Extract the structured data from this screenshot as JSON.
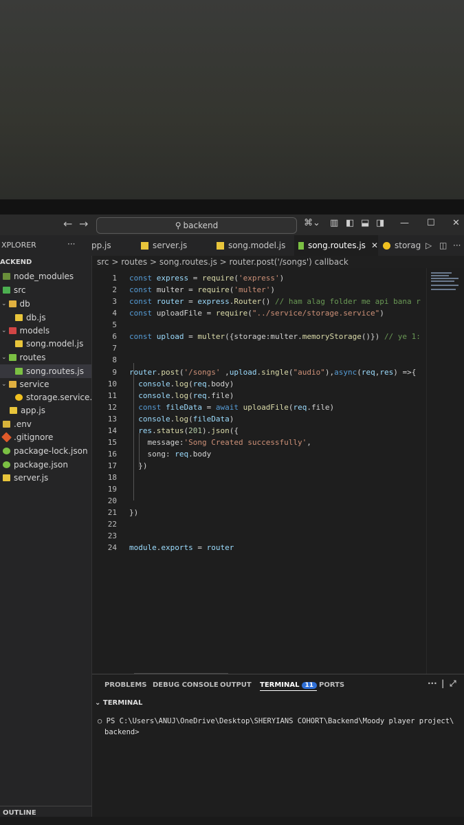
{
  "window": {
    "search": "backend"
  },
  "tabs": [
    {
      "label": "pp.js"
    },
    {
      "label": "server.js"
    },
    {
      "label": "song.model.js"
    },
    {
      "label": "song.routes.js",
      "active": true
    },
    {
      "label": "storag"
    }
  ],
  "sidebar": {
    "title": "XPLORER",
    "root": "ACKEND",
    "items": [
      {
        "label": "node_modules"
      },
      {
        "label": "src"
      },
      {
        "label": "db"
      },
      {
        "label": "db.js"
      },
      {
        "label": "models"
      },
      {
        "label": "song.model.js"
      },
      {
        "label": "routes"
      },
      {
        "label": "song.routes.js"
      },
      {
        "label": "service"
      },
      {
        "label": "storage.service.js"
      },
      {
        "label": "app.js"
      },
      {
        "label": ".env"
      },
      {
        "label": ".gitignore"
      },
      {
        "label": "package-lock.json"
      },
      {
        "label": "package.json"
      },
      {
        "label": "server.js"
      }
    ],
    "outline": "OUTLINE"
  },
  "breadcrumb": "src > routes > song.routes.js > router.post('/songs') callback",
  "code_lines": [
    "const express = require('express')",
    "const multer = require('multer')",
    "const router = express.Router() // ham alag folder me api bana r",
    "const uploadFile = require(\"../service/storage.service\")",
    "",
    "const upload = multer({storage:multer.memoryStorage()}) // ye 1:",
    "",
    "",
    "router.post('/songs' ,upload.single(\"audio\"),async(req,res) =>{",
    "  console.log(req.body)",
    "  console.log(req.file)",
    "  const fileData = await uploadFile(req.file)",
    "  console.log(fileData)",
    "  res.status(201).json({",
    "    message:'Song Created successfully',",
    "    song: req.body",
    "  })",
    "",
    "",
    "",
    "})",
    "",
    "",
    "module.exports = router"
  ],
  "panel": {
    "tabs": [
      "PROBLEMS",
      "DEBUG CONSOLE",
      "OUTPUT",
      "TERMINAL",
      "PORTS"
    ],
    "terminal_badge": "11",
    "section": "TERMINAL",
    "prompt_line1": "PS C:\\Users\\ANUJ\\OneDrive\\Desktop\\SHERYIANS COHORT\\Backend\\Moody player project\\",
    "prompt_line2": "backend>"
  },
  "colors": {
    "keyword": "#569cd6",
    "string": "#ce9178",
    "function": "#dcdcaa",
    "variable": "#9cdcfe",
    "comment": "#6a9955",
    "accent": "#2f6fd6"
  }
}
